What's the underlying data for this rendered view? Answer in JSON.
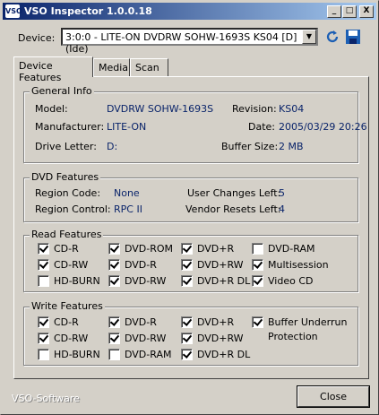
{
  "window": {
    "title": "VSO Inspector 1.0.0.18",
    "min": "_",
    "max": "□",
    "close": "X",
    "footer": "VSO-Software",
    "close_button": "Close"
  },
  "device": {
    "label": "Device:",
    "value": "3:0:0 - LITE-ON DVDRW SOHW-1693S KS04 [D] (Ide)"
  },
  "tabs": [
    "Device Features",
    "Media",
    "Scan"
  ],
  "general": {
    "title": "General Info",
    "model_label": "Model:",
    "model": "DVDRW SOHW-1693S",
    "manufacturer_label": "Manufacturer:",
    "manufacturer": "LITE-ON",
    "drive_label": "Drive Letter:",
    "drive": "D:",
    "revision_label": "Revision:",
    "revision": "KS04",
    "date_label": "Date:",
    "date": "2005/03/29 20:26",
    "buffer_label": "Buffer Size:",
    "buffer": "2 MB"
  },
  "dvd": {
    "title": "DVD Features",
    "region_code_label": "Region Code:",
    "region_code": "None",
    "region_control_label": "Region Control:",
    "region_control": "RPC II",
    "user_changes_label": "User Changes Left:",
    "user_changes": "5",
    "vendor_resets_label": "Vendor Resets Left:",
    "vendor_resets": "4"
  },
  "read": {
    "title": "Read Features",
    "items": [
      {
        "label": "CD-R",
        "checked": true
      },
      {
        "label": "DVD-ROM",
        "checked": true
      },
      {
        "label": "DVD+R",
        "checked": true
      },
      {
        "label": "DVD-RAM",
        "checked": false
      },
      {
        "label": "CD-RW",
        "checked": true
      },
      {
        "label": "DVD-R",
        "checked": true
      },
      {
        "label": "DVD+RW",
        "checked": true
      },
      {
        "label": "Multisession",
        "checked": true
      },
      {
        "label": "HD-BURN",
        "checked": false
      },
      {
        "label": "DVD-RW",
        "checked": true
      },
      {
        "label": "DVD+R DL",
        "checked": true
      },
      {
        "label": "Video CD",
        "checked": true
      }
    ]
  },
  "write": {
    "title": "Write Features",
    "items": [
      {
        "label": "CD-R",
        "checked": true
      },
      {
        "label": "DVD-R",
        "checked": true
      },
      {
        "label": "DVD+R",
        "checked": true
      },
      {
        "label": "Buffer Underrun",
        "checked": true
      },
      {
        "label": "CD-RW",
        "checked": true
      },
      {
        "label": "DVD-RW",
        "checked": true
      },
      {
        "label": "DVD+RW",
        "checked": true
      },
      {
        "label": "HD-BURN",
        "checked": false
      },
      {
        "label": "DVD-RAM",
        "checked": false
      },
      {
        "label": "DVD+R DL",
        "checked": true
      }
    ],
    "buffer_underrun_line2": "Protection"
  },
  "icons": {
    "refresh": "refresh-icon",
    "save": "save-icon",
    "app": "vso-app-icon"
  },
  "colors": {
    "value_text": "#0a246a",
    "title_bar_start": "#0a246a",
    "title_bar_end": "#a6caf0",
    "icon_blue": "#1c5fb4"
  }
}
